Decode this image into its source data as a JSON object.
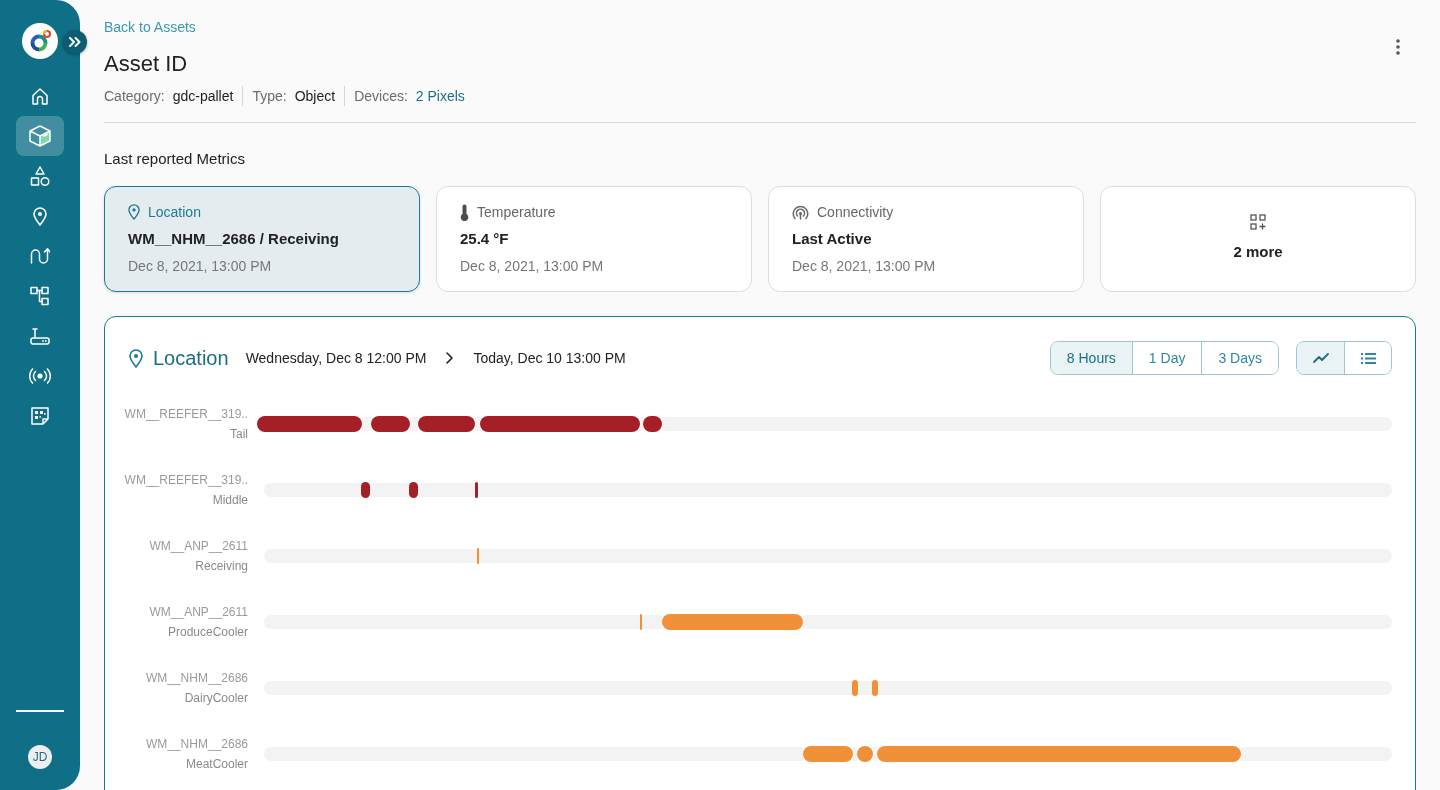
{
  "sidebar": {
    "items": [
      {
        "selected": false
      },
      {
        "selected": true
      },
      {
        "selected": false
      },
      {
        "selected": false
      },
      {
        "selected": false
      },
      {
        "selected": false
      },
      {
        "selected": false
      },
      {
        "selected": false
      },
      {
        "selected": false
      }
    ],
    "user": {
      "initials": "JD"
    }
  },
  "header": {
    "back_link": "Back to Assets",
    "title": "Asset ID",
    "meta": [
      {
        "kind": "text",
        "label": "Category:",
        "value": "gdc-pallet"
      },
      {
        "kind": "text",
        "label": "Type:",
        "value": "Object"
      },
      {
        "kind": "link",
        "label": "Devices:",
        "value": "2 Pixels"
      }
    ]
  },
  "metrics": {
    "title": "Last reported Metrics",
    "cards": [
      {
        "kind": "metric",
        "selected": true,
        "label": "Location",
        "value": "WM__NHM__2686 / Receiving",
        "time": "Dec 8, 2021, 13:00 PM"
      },
      {
        "kind": "metric",
        "selected": false,
        "label": "Temperature",
        "value": "25.4 °F",
        "time": "Dec 8, 2021, 13:00 PM"
      },
      {
        "kind": "metric",
        "selected": false,
        "label": "Connectivity",
        "value": "Last Active",
        "time": "Dec 8, 2021, 13:00 PM"
      },
      {
        "kind": "more",
        "selected": false,
        "value": "2 more"
      }
    ]
  },
  "timeline": {
    "title": "Location",
    "range": {
      "start": "Wednesday, Dec 8 12:00 PM",
      "end": "Today, Dec 10 13:00 PM"
    },
    "periods": [
      {
        "label": "8 Hours",
        "selected": true
      },
      {
        "label": "1 Day",
        "selected": false
      },
      {
        "label": "3 Days",
        "selected": false
      }
    ],
    "views": [
      {
        "selected": true
      },
      {
        "selected": false
      }
    ],
    "rows": [
      {
        "name": "WM__REEFER__319..",
        "zone": "Tail",
        "color": "#a51f27"
      },
      {
        "name": "WM__REEFER__319..",
        "zone": "Middle",
        "color": "#a51f27"
      },
      {
        "name": "WM__ANP__2611",
        "zone": "Receiving",
        "color": "#f0913a"
      },
      {
        "name": "WM__ANP__2611",
        "zone": "ProduceCooler",
        "color": "#f0913a"
      },
      {
        "name": "WM__NHM__2686",
        "zone": "DairyCooler",
        "color": "#f0913a"
      },
      {
        "name": "WM__NHM__2686",
        "zone": "MeatCooler",
        "color": "#f0913a"
      }
    ]
  }
}
